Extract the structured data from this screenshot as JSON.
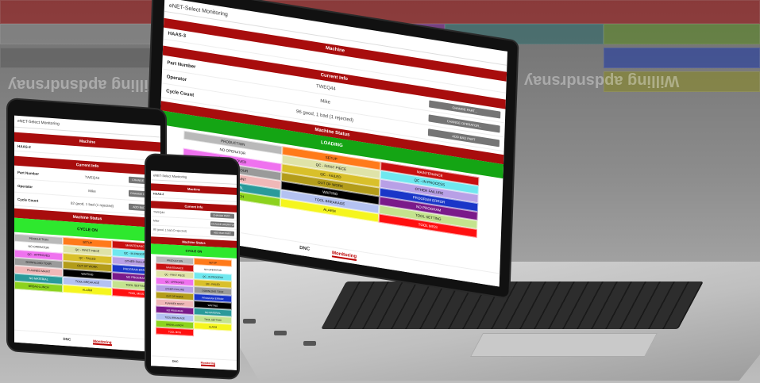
{
  "app": {
    "title": "eNET-Select Monitoring",
    "machine_header": "Machine",
    "machine_name_laptop": "HAAS-3",
    "machine_name_tablet": "HAAS-2",
    "machine_name_phone": "HAAS-2",
    "current_info_header": "Current Info",
    "part_number_label": "Part Number",
    "part_number_value": "TWEQ44",
    "part_number_value_tablet": "TWEQ44",
    "operator_label": "Operator",
    "operator_value": "Mike",
    "cycle_count_label": "Cycle Count",
    "cycle_count_value": "96 good, 1 bad (1 rejected)",
    "cycle_count_value_tablet": "82 good, 1 bad (1 rejected)",
    "cycle_count_value_phone": "80 good, 1 bad (0 rejected)",
    "buttons": [
      "CHANGE PART...",
      "CHANGE OPERATOR...",
      "ADD BAD PART"
    ],
    "machine_status_header": "Machine Status",
    "laptop_status": "LOADING",
    "tablet_status": "CYCLE ON",
    "phone_status": "CYCLE ON",
    "nav": {
      "dnc": "DNC",
      "monitoring": "Monitoring"
    }
  },
  "status_buttons": [
    {
      "label": "PRODUCTION",
      "color": "#b9b9b9"
    },
    {
      "label": "SETUP",
      "color": "#ff7a1a"
    },
    {
      "label": "MAINTENANCE",
      "color": "#c81010"
    },
    {
      "label": "NO OPERATOR",
      "color": "#ffffff"
    },
    {
      "label": "QC - FIRST PIECE",
      "color": "#dfe3a8"
    },
    {
      "label": "QC - IN PROCESS",
      "color": "#6fe8ef"
    },
    {
      "label": "QC - APPROVED",
      "color": "#ef72ef"
    },
    {
      "label": "QC - FAILED",
      "color": "#d9c02a"
    },
    {
      "label": "OTHER FAILURE",
      "color": "#b8a0e6"
    },
    {
      "label": "DOWNLOAD TOUR",
      "color": "#9a9a9a"
    },
    {
      "label": "OUT OF WORK",
      "color": "#b39c1a"
    },
    {
      "label": "PROGRAM ERROR",
      "color": "#1a36c8"
    },
    {
      "label": "PLANNED MAINT",
      "color": "#f0b8b8"
    },
    {
      "label": "WAITING",
      "color": "#000000"
    },
    {
      "label": "NO PROGRAM",
      "color": "#7a1a8a"
    },
    {
      "label": "NO MATERIAL",
      "color": "#2a9a9a"
    },
    {
      "label": "TOOL BREAKAGE",
      "color": "#b4c2f2"
    },
    {
      "label": "TOOL SETTING",
      "color": "#c4e38e"
    },
    {
      "label": "BREAK-LUNCH",
      "color": "#8cd21e"
    },
    {
      "label": "ALARM",
      "color": "#f5f51e"
    },
    {
      "label": "TOOL MISS",
      "color": "#ff1010"
    }
  ],
  "background": {
    "text_a": "Willing apdsndrsnay",
    "text_b": "Willing apdsndrsnay"
  }
}
